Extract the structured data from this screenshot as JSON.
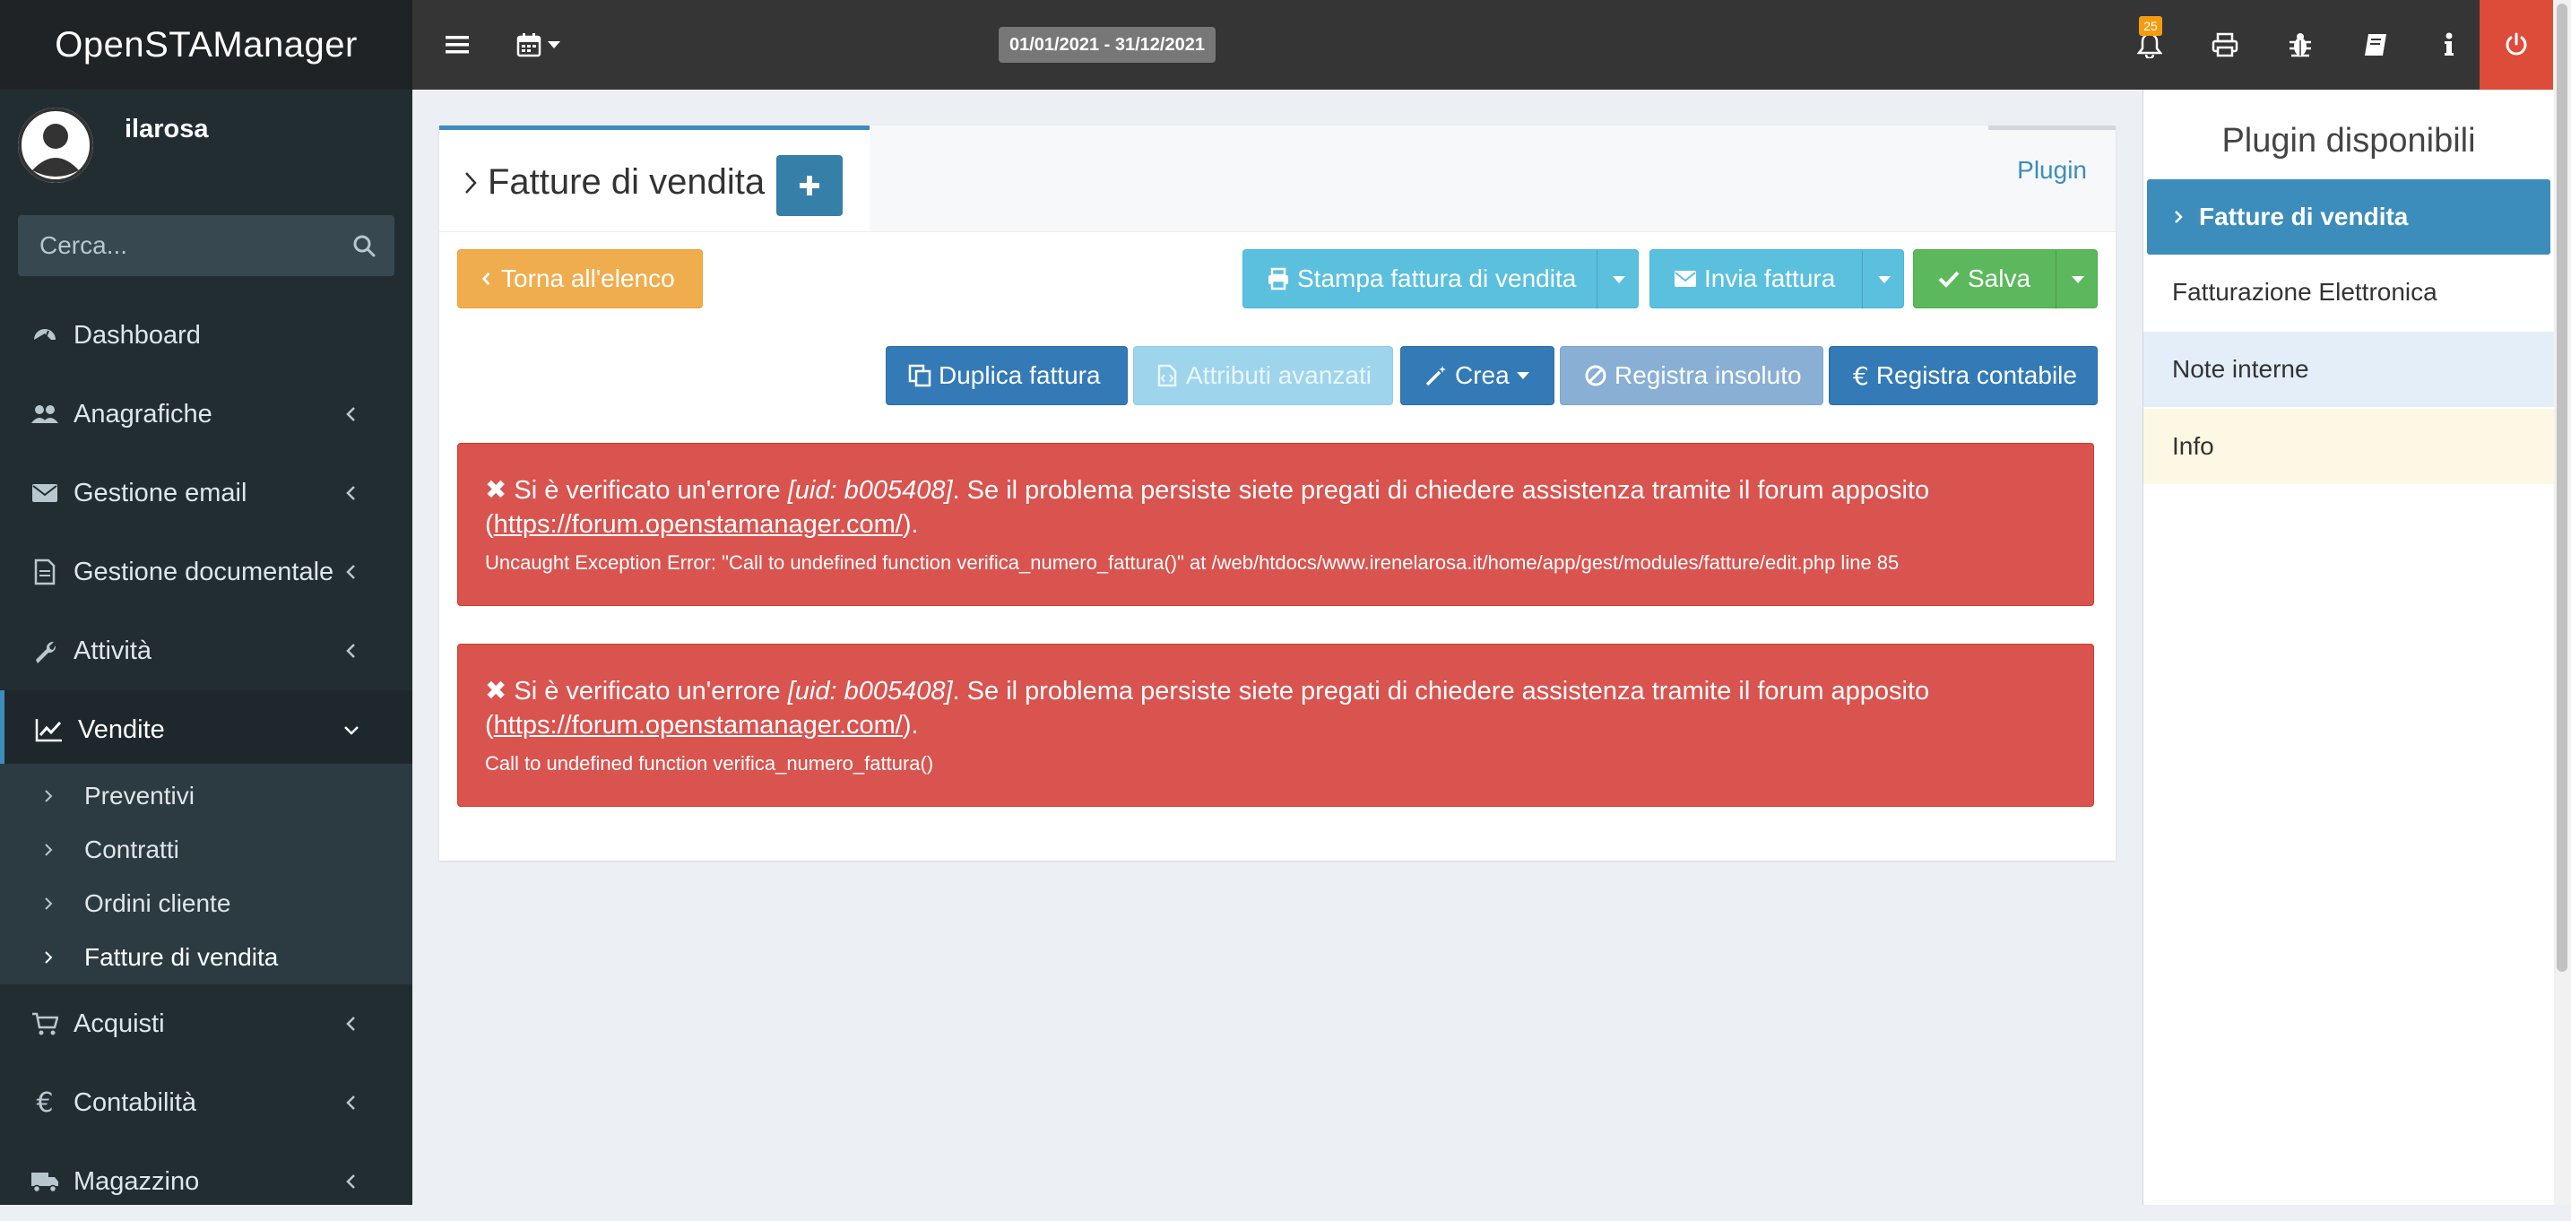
{
  "app": {
    "title": "OpenSTAManager"
  },
  "user": {
    "name": "ilarosa"
  },
  "sidebar": {
    "search_placeholder": "Cerca...",
    "items": [
      {
        "label": "Dashboard",
        "icon": "dashboard-icon"
      },
      {
        "label": "Anagrafiche",
        "icon": "users-icon"
      },
      {
        "label": "Gestione email",
        "icon": "envelope-icon"
      },
      {
        "label": "Gestione documentale",
        "icon": "document-icon"
      },
      {
        "label": "Attività",
        "icon": "wrench-icon"
      },
      {
        "label": "Vendite",
        "icon": "line-chart-icon"
      },
      {
        "label": "Acquisti",
        "icon": "cart-icon"
      },
      {
        "label": "Contabilità",
        "icon": "euro-icon"
      },
      {
        "label": "Magazzino",
        "icon": "truck-icon"
      }
    ],
    "vendite_sub": [
      {
        "label": "Preventivi"
      },
      {
        "label": "Contratti"
      },
      {
        "label": "Ordini cliente"
      },
      {
        "label": "Fatture di vendita"
      }
    ]
  },
  "navbar": {
    "date_range": "01/01/2021 - 31/12/2021",
    "notification_count": "25"
  },
  "page": {
    "title": "Fatture di vendita",
    "plugin_tab": "Plugin"
  },
  "buttons": {
    "back": "Torna all'elenco",
    "print": "Stampa fattura di vendita",
    "send": "Invia fattura",
    "save": "Salva",
    "duplicate": "Duplica fattura",
    "attributes": "Attributi avanzati",
    "create": "Crea",
    "unpaid": "Registra insoluto",
    "accounting": "Registra contabile"
  },
  "alerts": [
    {
      "prefix": "Si è verificato un'errore ",
      "uid": "[uid: b005408]",
      "message": ". Se il problema persiste siete pregati di chiedere assistenza tramite il forum apposito",
      "link_open": "(",
      "link": "https://forum.openstamanager.com/",
      "link_close": ").",
      "detail": "Uncaught Exception Error: \"Call to undefined function verifica_numero_fattura()\" at /web/htdocs/www.irenelarosa.it/home/app/gest/modules/fatture/edit.php line 85"
    },
    {
      "prefix": "Si è verificato un'errore ",
      "uid": "[uid: b005408]",
      "message": ". Se il problema persiste siete pregati di chiedere assistenza tramite il forum apposito",
      "link_open": "(",
      "link": "https://forum.openstamanager.com/",
      "link_close": ").",
      "detail": "Call to undefined function verifica_numero_fattura()"
    }
  ],
  "right_panel": {
    "title": "Plugin disponibili",
    "items": [
      {
        "label": "Fatture di vendita"
      },
      {
        "label": "Fatturazione Elettronica"
      },
      {
        "label": "Note interne"
      },
      {
        "label": "Info"
      }
    ]
  },
  "colors": {
    "sidebar": "#222d32",
    "navbar": "#353535",
    "primary": "#3c8dbc",
    "danger": "#d9534f",
    "warning": "#f0ad4e",
    "success": "#5cb85c",
    "info": "#5bc0de"
  }
}
